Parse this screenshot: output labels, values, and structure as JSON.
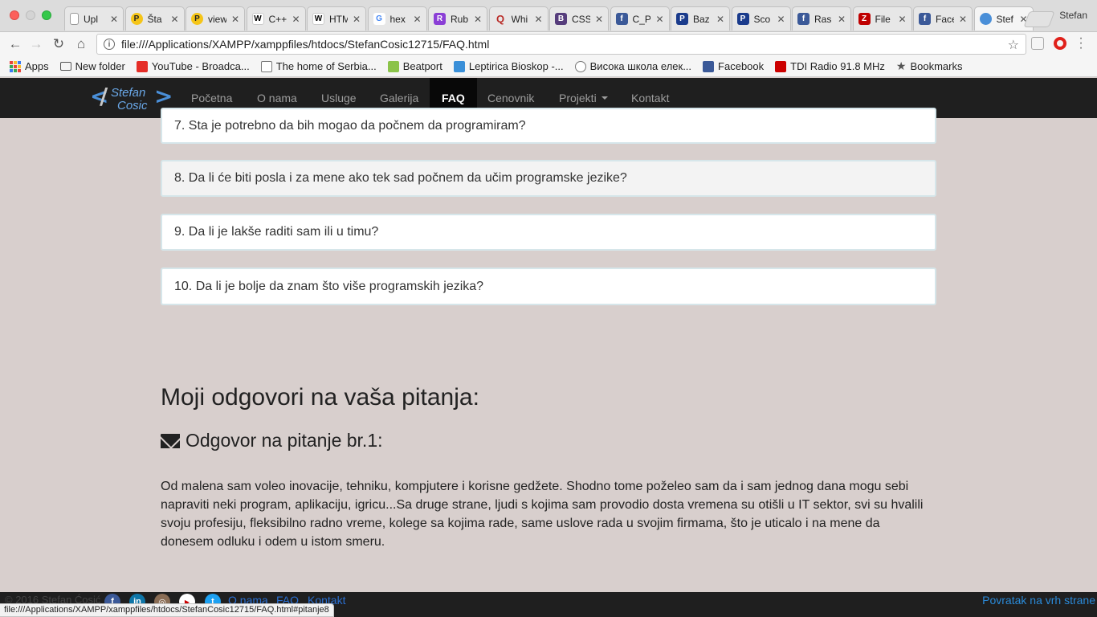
{
  "browser": {
    "tabs": [
      {
        "title": "Upl",
        "fav": "doc",
        "color": "#888888"
      },
      {
        "title": "Šta",
        "fav": "P",
        "color": "#222222"
      },
      {
        "title": "view",
        "fav": "P",
        "color": "#222222"
      },
      {
        "title": "C++",
        "fav": "W",
        "color": "#ffffff"
      },
      {
        "title": "HTM",
        "fav": "W",
        "color": "#ffffff"
      },
      {
        "title": "hex",
        "fav": "G",
        "color": "#4285f4"
      },
      {
        "title": "Rub",
        "fav": "R",
        "color": "#8b3fd6"
      },
      {
        "title": "Whi",
        "fav": "Q",
        "color": "#b92b27"
      },
      {
        "title": "CSS",
        "fav": "B",
        "color": "#563d7c"
      },
      {
        "title": "C_P",
        "fav": "f",
        "color": "#3b5998"
      },
      {
        "title": "Baz",
        "fav": "P",
        "color": "#1a3b8c"
      },
      {
        "title": "Sco",
        "fav": "P",
        "color": "#1a3b8c"
      },
      {
        "title": "Ras",
        "fav": "f",
        "color": "#3b5998"
      },
      {
        "title": "File",
        "fav": "Z",
        "color": "#bf0000"
      },
      {
        "title": "Face",
        "fav": "f",
        "color": "#3b5998"
      },
      {
        "title": "Stef",
        "fav": "globe",
        "color": "#4a8fd8"
      }
    ],
    "tab_close": "✕",
    "profile_name": "Stefan",
    "url": "file:///Applications/XAMPP/xamppfiles/htdocs/StefanCosic12715/FAQ.html",
    "bookmarks": [
      {
        "label": "Apps",
        "icon": "apps-icon"
      },
      {
        "label": "New folder",
        "icon": "folder-icon"
      },
      {
        "label": "YouTube - Broadca...",
        "icon": "youtube-icon"
      },
      {
        "label": "The home of Serbia...",
        "icon": "page-icon"
      },
      {
        "label": "Beatport",
        "icon": "beatport-icon"
      },
      {
        "label": "Leptirica Bioskop -...",
        "icon": "leptirica-icon"
      },
      {
        "label": "Висока школа елек...",
        "icon": "wave-icon"
      },
      {
        "label": "Facebook",
        "icon": "facebook-icon"
      },
      {
        "label": "TDI Radio 91.8 MHz",
        "icon": "tdi-icon"
      },
      {
        "label": "Bookmarks",
        "icon": "star-icon"
      }
    ]
  },
  "site": {
    "logo_line1": "Stefan",
    "logo_line2": "Cosic",
    "nav": [
      {
        "label": "Početna"
      },
      {
        "label": "O nama"
      },
      {
        "label": "Usluge"
      },
      {
        "label": "Galerija"
      },
      {
        "label": "FAQ",
        "active": true
      },
      {
        "label": "Cenovnik"
      },
      {
        "label": "Projekti",
        "dropdown": true
      },
      {
        "label": "Kontakt"
      }
    ],
    "faq_items": [
      "7. Sta je potrebno da bih mogao da počnem da programiram?",
      "8. Da li će biti posla i za mene ako tek sad počnem da učim programske jezike?",
      "9. Da li je lakše raditi sam ili u timu?",
      "10. Da li je bolje da znam što više programskih jezika?"
    ],
    "answers_heading": "Moji odgovori na vaša pitanja:",
    "answer_title": "Odgovor na pitanje br.1:",
    "answer_text": "Od malena sam voleo inovacije, tehniku, kompjutere i korisne gedžete. Shodno tome poželeo sam da i sam jednog dana mogu sebi napraviti neki program, aplikaciju, igricu...Sa druge strane, ljudi s kojima sam provodio dosta vremena su otišli u IT sektor, svi su hvalili svoju profesiju, fleksibilno radno vreme, kolege sa kojima rade, same uslove rada u svojim firmama, što je uticalo i na mene da donesem odluku i odem u istom smeru.",
    "footer": {
      "copyright": "© 2016 Stefan Ćosić",
      "links": [
        "O nama",
        "FAQ",
        "Kontakt"
      ],
      "back_to_top": "Povratak na vrh strane"
    }
  },
  "status_url": "file:///Applications/XAMPP/xamppfiles/htdocs/StefanCosic12715/FAQ.html#pitanje8"
}
